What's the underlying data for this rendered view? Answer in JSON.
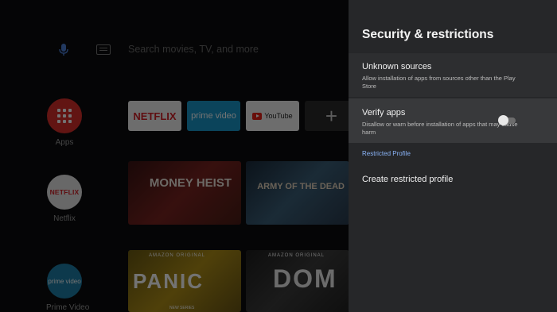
{
  "launcher": {
    "search_placeholder": "Search movies, TV, and more",
    "sidebar": [
      {
        "label": "Apps"
      },
      {
        "label": "Netflix",
        "icon_text": "NETFLIX"
      },
      {
        "label": "Prime Video",
        "icon_text": "prime video"
      }
    ],
    "favorites": [
      {
        "text": "NETFLIX"
      },
      {
        "text": "prime video"
      },
      {
        "text": "YouTube"
      },
      {
        "text": "+"
      }
    ],
    "posters": [
      {
        "title": "MONEY HEIST"
      },
      {
        "title": "ARMY OF THE DEAD"
      },
      {
        "tagline": "AMAZON ORIGINAL",
        "title": "PANIC",
        "subtitle": "NEW SERIES"
      },
      {
        "tagline": "AMAZON ORIGINAL",
        "title": "DOM"
      }
    ]
  },
  "panel": {
    "title": "Security & restrictions",
    "items": [
      {
        "title": "Unknown sources",
        "subtitle": "Allow installation of apps from sources other than the Play Store"
      },
      {
        "title": "Verify apps",
        "subtitle": "Disallow or warn before installation of apps that may cause harm",
        "toggle": "off"
      }
    ],
    "section_header": "Restricted Profile",
    "create_label": "Create restricted profile"
  },
  "colors": {
    "panel_bg": "#262729",
    "selected_row": "#38393b",
    "section_accent": "#8ab4f8",
    "apps_red": "#d9302b"
  }
}
